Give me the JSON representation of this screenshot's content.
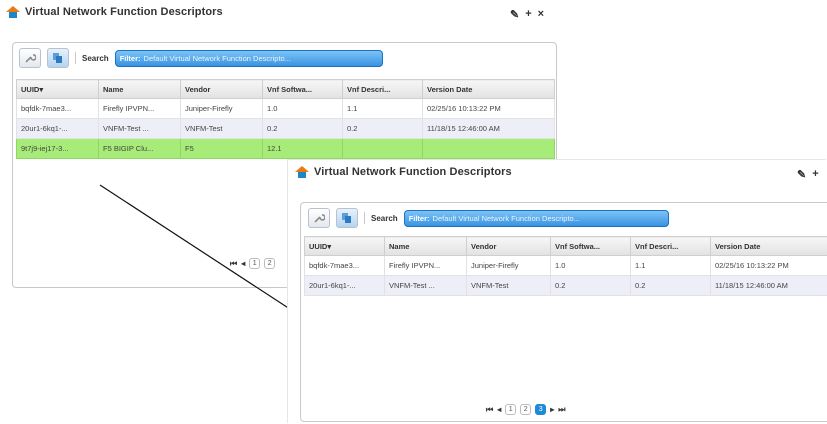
{
  "background_window": {
    "title": "Virtual Network Function Descriptors",
    "controls": {
      "pin": "✎",
      "add": "+",
      "close": "×"
    },
    "toolbar": {
      "search_label": "Search",
      "filter_key": "Filter:",
      "filter_value": "Default Virtual Network Function Descripto..."
    },
    "columns": [
      "UUID▾",
      "Name",
      "Vendor",
      "Vnf Softwa...",
      "Vnf Descri...",
      "Version Date"
    ],
    "rows": [
      [
        "bqfdk-7mae3...",
        "Firefly IPVPN...",
        "Juniper-Firefly",
        "1.0",
        "1.1",
        "02/25/16 10:13:22 PM"
      ],
      [
        "20ur1-6kq1-...",
        "VNFM-Test ...",
        "VNFM-Test",
        "0.2",
        "0.2",
        "11/18/15 12:46:00 AM"
      ],
      [
        "9t7j9-iej17-3...",
        "F5 BIGIP Clu...",
        "F5",
        "12.1",
        "",
        ""
      ]
    ],
    "pager": {
      "first": "⏮",
      "prev": "◂",
      "pages": [
        "1",
        "2"
      ]
    }
  },
  "foreground_window": {
    "title": "Virtual Network Function Descriptors",
    "controls": {
      "pin": "✎",
      "add": "+"
    },
    "toolbar": {
      "search_label": "Search",
      "filter_key": "Filter:",
      "filter_value": "Default Virtual Network Function Descripto..."
    },
    "columns": [
      "UUID▾",
      "Name",
      "Vendor",
      "Vnf Softwa...",
      "Vnf Descri...",
      "Version Date"
    ],
    "rows": [
      [
        "bqfdk-7mae3...",
        "Firefly IPVPN...",
        "Juniper-Firefly",
        "1.0",
        "1.1",
        "02/25/16 10:13:22 PM"
      ],
      [
        "20ur1-6kq1-...",
        "VNFM-Test ...",
        "VNFM-Test",
        "0.2",
        "0.2",
        "11/18/15 12:46:00 AM"
      ]
    ],
    "pager": {
      "first": "⏮",
      "prev": "◂",
      "pages": [
        "1",
        "2",
        "3"
      ],
      "active_page": "3",
      "next": "▸",
      "last": "⏭"
    }
  },
  "colors": {
    "selected_row": "#a7ec79",
    "filter_blue": "#3a93e0",
    "active_page": "#1f8ad6",
    "house_roof": "#e87a12",
    "house_base": "#1c86c8"
  },
  "icons": [
    "house-icon",
    "wrench-icon",
    "copy-icon",
    "pin-icon"
  ]
}
